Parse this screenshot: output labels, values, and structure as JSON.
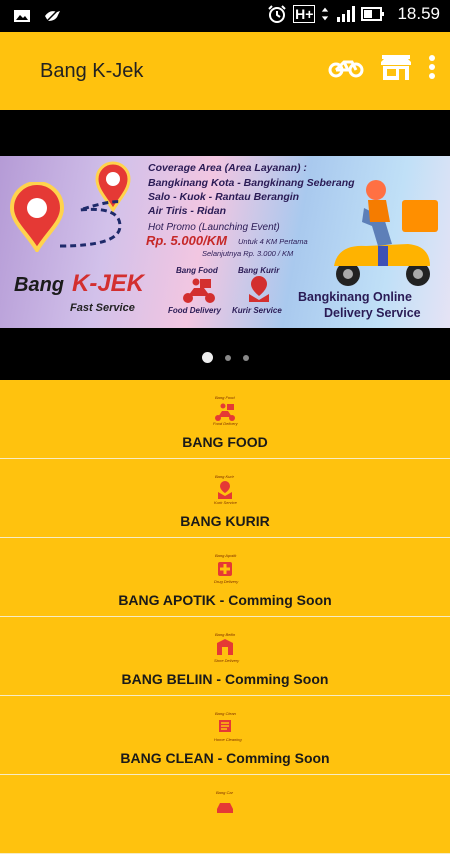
{
  "status_bar": {
    "time": "18.59",
    "network": "H+"
  },
  "app_bar": {
    "title": "Bang K-Jek"
  },
  "banner": {
    "coverage_title": "Coverage Area (Area Layanan) :",
    "coverage_lines": [
      "Bangkinang Kota - Bangkinang Seberang",
      "Salo - Kuok - Rantau Berangin",
      "Air Tiris - Ridan"
    ],
    "promo_title": "Hot Promo (Launching Event)",
    "promo_price": "Rp. 5.000/KM",
    "promo_note": "Untuk 4 KM Pertama",
    "promo_next": "Selanjutnya Rp. 3.000 / KM",
    "brand_left": "Bang",
    "brand_right": "K-JEK",
    "tagline": "Fast Service",
    "food_title": "Bang Food",
    "food_caption": "Food Delivery",
    "kurir_title": "Bang Kurir",
    "kurir_caption": "Kurir Service",
    "online_line1": "Bangkinang Online",
    "online_line2": "Delivery Service"
  },
  "carousel": {
    "pages": 3,
    "active": 0
  },
  "menu": [
    {
      "label": "BANG FOOD",
      "icon": "food-delivery-icon",
      "icon_title": "Bang Food",
      "icon_caption": "Food Delivery"
    },
    {
      "label": "BANG KURIR",
      "icon": "courier-icon",
      "icon_title": "Bang Kurir",
      "icon_caption": "Kurir Service"
    },
    {
      "label": "BANG APOTIK - Comming Soon",
      "icon": "pharmacy-icon",
      "icon_title": "Bang Apotik",
      "icon_caption": "Drug Delivery"
    },
    {
      "label": "BANG BELIIN - Comming Soon",
      "icon": "shopping-icon",
      "icon_title": "Bang Beliin",
      "icon_caption": "Store Delivery"
    },
    {
      "label": "BANG CLEAN - Comming Soon",
      "icon": "cleaning-icon",
      "icon_title": "Bang Clean",
      "icon_caption": "Home Cleaning"
    },
    {
      "label": "",
      "icon": "car-icon",
      "icon_title": "Bang Car",
      "icon_caption": ""
    }
  ],
  "colors": {
    "accent": "#FFC20E",
    "icon_red": "#E53935"
  }
}
